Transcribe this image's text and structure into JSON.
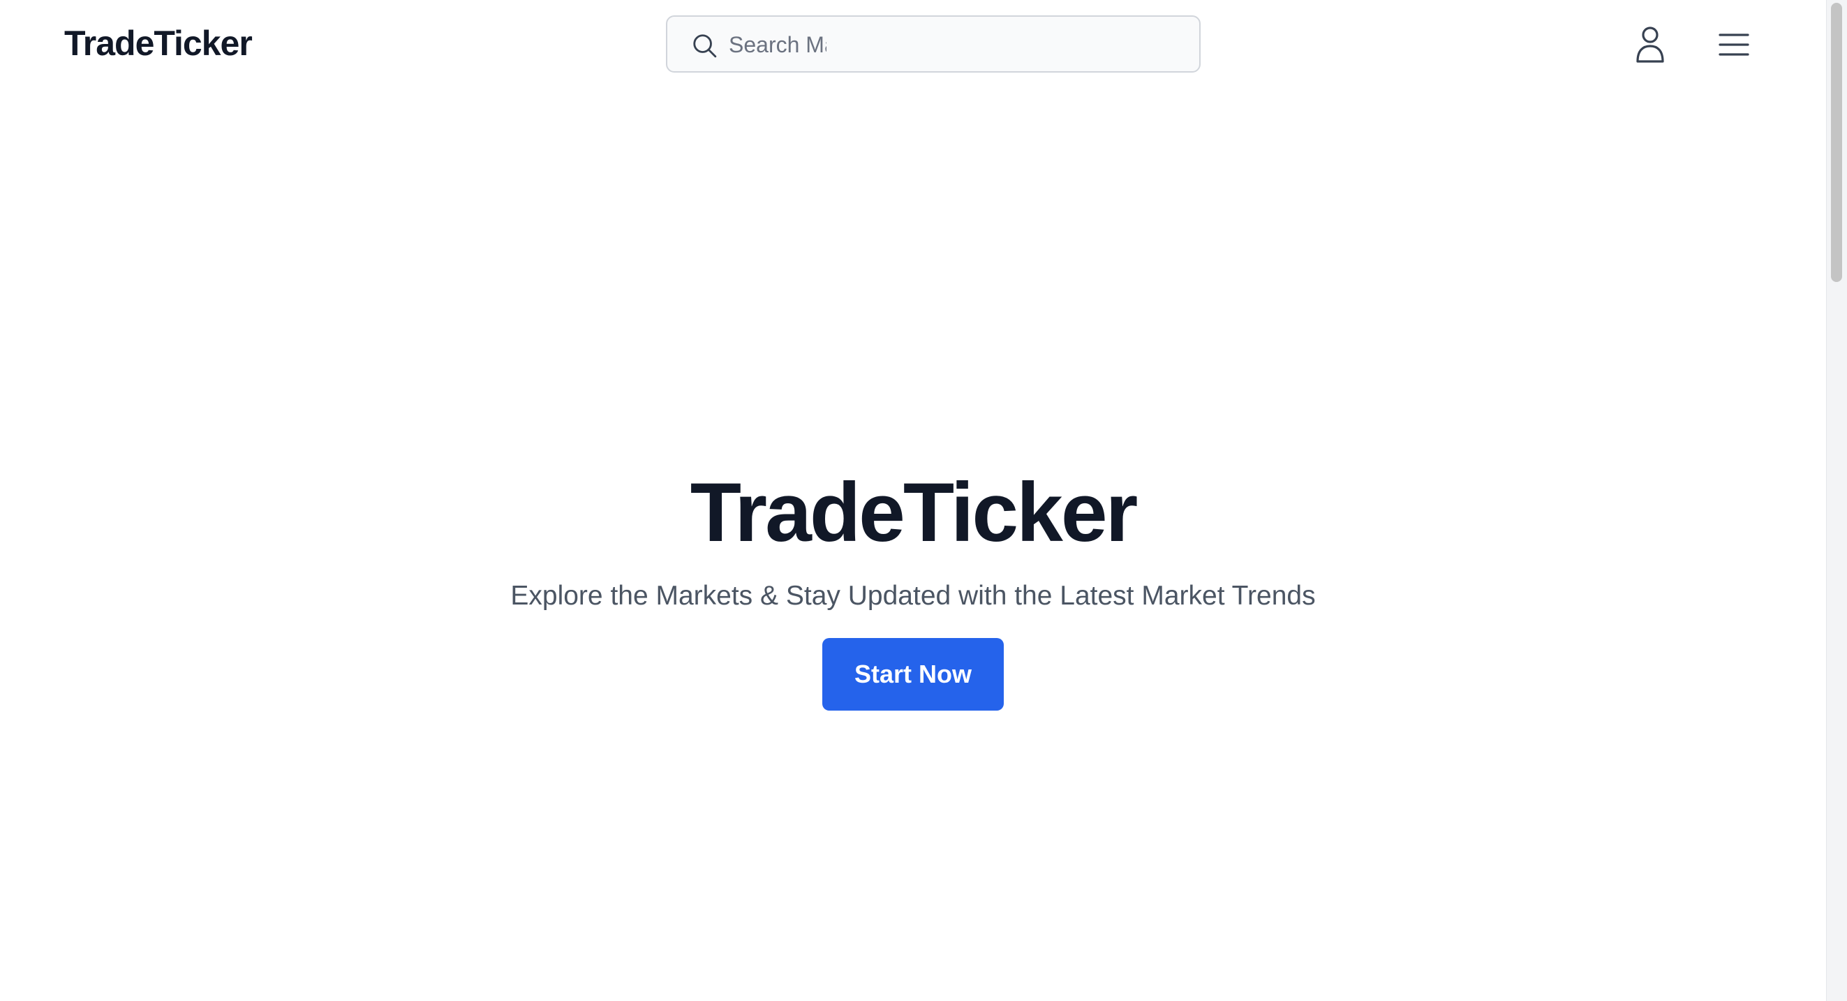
{
  "header": {
    "brand": "TradeTicker",
    "search": {
      "placeholder": "Search Markets"
    },
    "icons": {
      "search": "search-icon",
      "user": "user-icon",
      "menu": "hamburger-menu-icon"
    }
  },
  "hero": {
    "title": "TradeTicker",
    "subtitle": "Explore the Markets & Stay Updated with the Latest Market Trends",
    "cta_label": "Start Now"
  },
  "colors": {
    "brand_text": "#111827",
    "subtitle_text": "#4b5563",
    "accent": "#2563eb",
    "search_bg": "#f9fafb",
    "search_border": "#d1d5db"
  }
}
